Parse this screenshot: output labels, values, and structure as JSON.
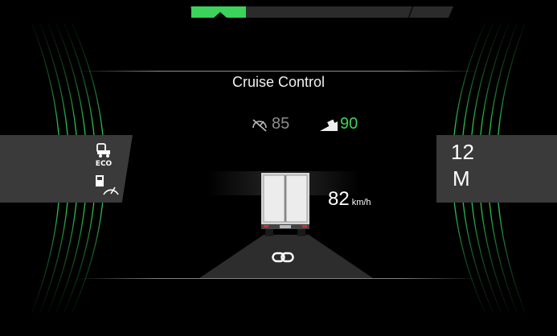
{
  "cruise": {
    "title": "Cruise Control",
    "set_speed": "85",
    "downhill_speed": "90"
  },
  "vehicle": {
    "speed": "82",
    "speed_unit": "km/h"
  },
  "gear": {
    "number": "12",
    "mode": "M"
  },
  "icons": {
    "left_panel": [
      "eco-mode-icon",
      "traction-speed-icon"
    ],
    "set_speed": "speedometer-icon",
    "downhill": "downhill-truck-icon",
    "follow": "vehicle-link-icon"
  },
  "colors": {
    "accent": "#3bd35a",
    "panel": "#3a3a3a",
    "background": "#000000"
  }
}
